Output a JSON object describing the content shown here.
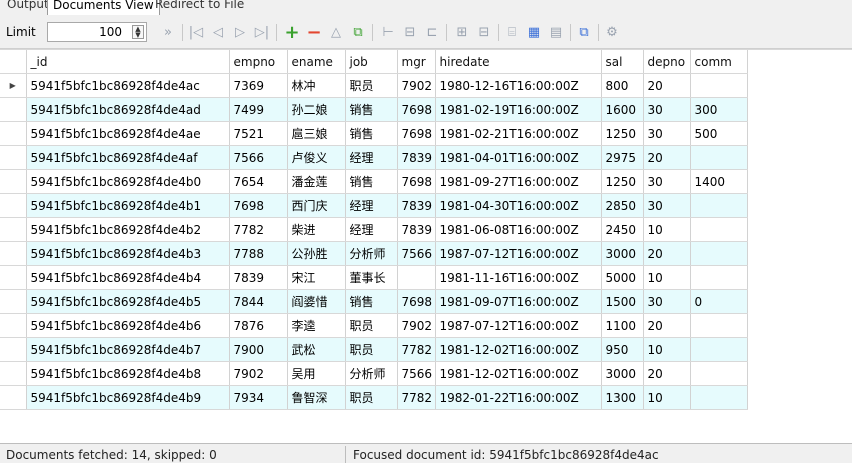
{
  "tabs": [
    {
      "label": "Output",
      "active": false
    },
    {
      "label": "Documents View",
      "active": true
    },
    {
      "label": "Redirect to File",
      "active": false
    }
  ],
  "toolbar": {
    "limit_label": "Limit",
    "limit_value": "100",
    "icons": [
      "fast-forward-icon",
      "first-record-icon",
      "previous-record-icon",
      "next-record-icon",
      "last-record-icon",
      "add-icon",
      "delete-icon",
      "up-icon",
      "copy-add-icon",
      "insert-icon",
      "minus-icon",
      "collapse-icon",
      "grid-icon",
      "grid2-icon",
      "text-view-icon",
      "grid-view-icon",
      "form-view-icon",
      "export-icon",
      "settings-icon"
    ],
    "accent_add": "#3aa12e",
    "accent_delete": "#e3452f"
  },
  "table": {
    "columns": [
      "_id",
      "empno",
      "ename",
      "job",
      "mgr",
      "hiredate",
      "sal",
      "depno",
      "comm"
    ],
    "rows": [
      [
        "5941f5bfc1bc86928f4de4ac",
        "7369",
        "林冲",
        "职员",
        "7902",
        "1980-12-16T16:00:00Z",
        "800",
        "20",
        ""
      ],
      [
        "5941f5bfc1bc86928f4de4ad",
        "7499",
        "孙二娘",
        "销售",
        "7698",
        "1981-02-19T16:00:00Z",
        "1600",
        "30",
        "300"
      ],
      [
        "5941f5bfc1bc86928f4de4ae",
        "7521",
        "扈三娘",
        "销售",
        "7698",
        "1981-02-21T16:00:00Z",
        "1250",
        "30",
        "500"
      ],
      [
        "5941f5bfc1bc86928f4de4af",
        "7566",
        "卢俊义",
        "经理",
        "7839",
        "1981-04-01T16:00:00Z",
        "2975",
        "20",
        ""
      ],
      [
        "5941f5bfc1bc86928f4de4b0",
        "7654",
        "潘金莲",
        "销售",
        "7698",
        "1981-09-27T16:00:00Z",
        "1250",
        "30",
        "1400"
      ],
      [
        "5941f5bfc1bc86928f4de4b1",
        "7698",
        "西门庆",
        "经理",
        "7839",
        "1981-04-30T16:00:00Z",
        "2850",
        "30",
        ""
      ],
      [
        "5941f5bfc1bc86928f4de4b2",
        "7782",
        "柴进",
        "经理",
        "7839",
        "1981-06-08T16:00:00Z",
        "2450",
        "10",
        ""
      ],
      [
        "5941f5bfc1bc86928f4de4b3",
        "7788",
        "公孙胜",
        "分析师",
        "7566",
        "1987-07-12T16:00:00Z",
        "3000",
        "20",
        ""
      ],
      [
        "5941f5bfc1bc86928f4de4b4",
        "7839",
        "宋江",
        "董事长",
        "",
        "1981-11-16T16:00:00Z",
        "5000",
        "10",
        ""
      ],
      [
        "5941f5bfc1bc86928f4de4b5",
        "7844",
        "阎婆惜",
        "销售",
        "7698",
        "1981-09-07T16:00:00Z",
        "1500",
        "30",
        "0"
      ],
      [
        "5941f5bfc1bc86928f4de4b6",
        "7876",
        "李逵",
        "职员",
        "7902",
        "1987-07-12T16:00:00Z",
        "1100",
        "20",
        ""
      ],
      [
        "5941f5bfc1bc86928f4de4b7",
        "7900",
        "武松",
        "职员",
        "7782",
        "1981-12-02T16:00:00Z",
        "950",
        "10",
        ""
      ],
      [
        "5941f5bfc1bc86928f4de4b8",
        "7902",
        "吴用",
        "分析师",
        "7566",
        "1981-12-02T16:00:00Z",
        "3000",
        "20",
        ""
      ],
      [
        "5941f5bfc1bc86928f4de4b9",
        "7934",
        "鲁智深",
        "职员",
        "7782",
        "1982-01-22T16:00:00Z",
        "1300",
        "10",
        ""
      ]
    ],
    "row_highlight": "#e6fbfd"
  },
  "status": {
    "left": "Documents fetched: 14, skipped: 0",
    "right": "Focused document id: 5941f5bfc1bc86928f4de4ac"
  }
}
